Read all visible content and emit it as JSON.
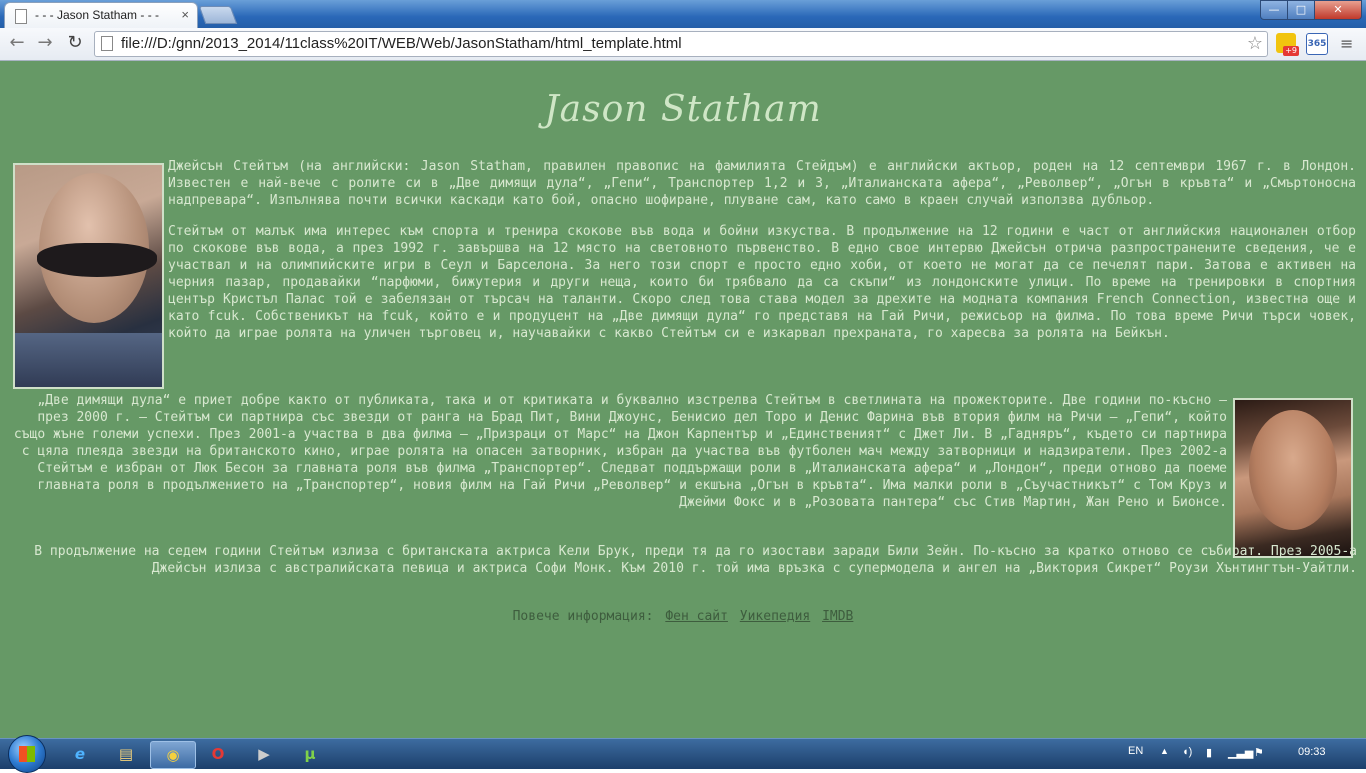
{
  "browser": {
    "tab_title": "- - - Jason Statham - - -",
    "tab_close": "×",
    "url": "file:///D:/gnn/2013_2014/11class%20IT/WEB/Web/JasonStatham/html_template.html",
    "back_icon": "←",
    "forward_icon": "→",
    "reload_icon": "↻",
    "star_icon": "☆",
    "menu_icon": "≡",
    "window_min": "—",
    "window_max": "□",
    "window_close": "✕",
    "ext_badge": "+9",
    "ext_365": "365"
  },
  "page": {
    "title": "Jason Statham",
    "paragraph1": "Джейсън Стейтъм (на английски: Jason Statham, правилен правопис на фамилията Стейдъм) е английски актьор, роден на 12 септември 1967 г. в Лондон. Известен е най-вече с ролите си в „Две димящи дула“, „Гепи“, Транспортер 1,2 и 3, „Италианската афера“, „Револвер“, „Огън в кръвта“ и „Смъртоносна надпревара“. Изпълнява почти всички каскади като бой, опасно шофиране, плуване сам, като само в краен случай използва дубльор.",
    "paragraph2": "Стейтъм от малък има интерес към спорта и тренира скокове във вода и бойни изкуства. В продължение на 12 години е част от английския национален отбор по скокове във вода, а през 1992 г. завършва на 12 място на световното първенство. В едно свое интервю Джейсън отрича разпространените сведения, че е участвал и на олимпийските игри в Сеул и Барселона. За него този спорт е просто едно хоби, от което не могат да се печелят пари. Затова е активен на черния пазар, продавайки “парфюми, бижутерия и други неща, които би трябвало да са скъпи“ из лондонските улици. По време на тренировки в спортния център Кристъл Палас той е забелязан от търсач на таланти. Скоро след това става модел за дрехите на модната компания French Connection, известна още и като fcuk. Собственикът на fcuk, който е и продуцент на „Две димящи дула“ го представя на Гай Ричи, режисьор на филма. По това време Ричи търси човек, който да играе ролята на уличен търговец и, научавайки с какво Стейтъм си е изкарвал прехраната, го харесва за ролята на Бейкън.",
    "paragraph3": "„Две димящи дула“ е приет добре както от публиката, така и от критиката и буквално изстрелва Стейтъм в светлината на прожекторите. Две години по-късно — през 2000 г. – Стейтъм си партнира със звезди от ранга на Брад Пит, Вини Джоунс, Бенисио дел Торо и Денис Фарина във втория филм на Ричи – „Гепи“, който също жъне големи успехи. През 2001-а участва в два филма – „Призраци от Марс“ на Джон Карпентър и „Единственият“ с Джет Ли. В „Гадняръ“, където си партнира с цяла плеяда звезди на британското кино, играе ролята на опасен затворник, избран да участва във футболен мач между затворници и надзиратели. През 2002-а Стейтъм е избран от Люк Бесон за главната роля във филма „Транспортер“. Следват поддържащи роли в „Италианската афера“ и „Лондон“, преди отново да поеме главната роля в продължението на „Транспортер“, новия филм на Гай Ричи „Револвер“ и екшъна „Огън в кръвта“. Има малки роли в „Съучастникът“ с Том Круз и Джейми Фокс и в „Розовата пантера“ със Стив Мартин, Жан Рено и Бионсе.",
    "paragraph4": "В продължение на седем години Стейтъм излиза с британската актриса Кели Брук, преди тя да го изостави заради Били Зейн. По-късно за кратко отново се събират. През 2005-а Джейсън излиза с австралийската певица и актриса Софи Монк. Към 2010 г. той има връзка с супермодела и ангел на „Виктория Сикрет“ Роузи Хънтингтън-Уайтли.",
    "more_info_label": "Повече информация:",
    "links": [
      "Фен сайт",
      "Уикепедия",
      "IMDB"
    ]
  },
  "taskbar": {
    "language": "EN",
    "clock": "09:33",
    "tray_up_icon": "▲",
    "ie_icon": "e",
    "folder_icon": "▤",
    "chrome_icon": "◉",
    "opera_icon": "O",
    "media_icon": "▶",
    "torrent_icon": "µ"
  },
  "colors": {
    "page_background": "#669966",
    "body_text": "#d8e8d0",
    "link_text": "#3e5d3e"
  }
}
